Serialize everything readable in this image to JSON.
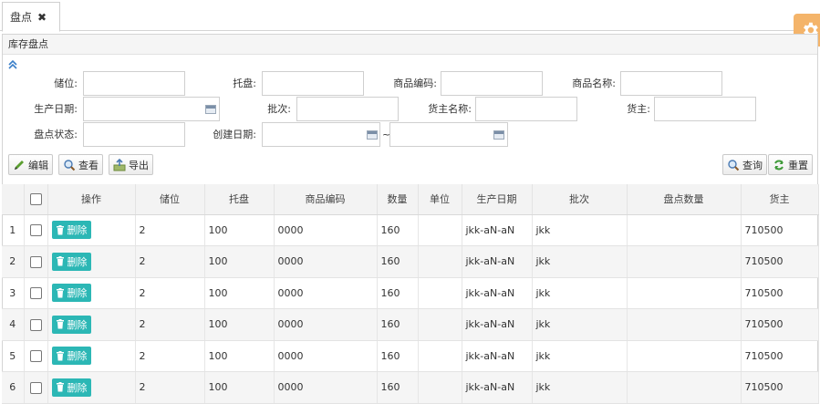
{
  "tab": {
    "label": "盘点",
    "close": "✖"
  },
  "panel": {
    "title": "库存盘点"
  },
  "form": {
    "location_label": "储位:",
    "pallet_label": "托盘:",
    "product_code_label": "商品编码:",
    "product_name_label": "商品名称:",
    "production_date_label": "生产日期:",
    "batch_label": "批次:",
    "owner_name_label": "货主名称:",
    "owner_label": "货主:",
    "count_status_label": "盘点状态:",
    "created_date_label": "创建日期:",
    "range_separator": "~"
  },
  "toolbar": {
    "edit": "编辑",
    "view": "查看",
    "export": "导出",
    "query": "查询",
    "reset": "重置"
  },
  "table": {
    "columns": [
      "",
      "操作",
      "储位",
      "托盘",
      "商品编码",
      "数量",
      "单位",
      "生产日期",
      "批次",
      "盘点数量",
      "货主"
    ],
    "delete_label": "删除",
    "rows": [
      {
        "no": "1",
        "loc": "2",
        "pallet": "100",
        "code": "0000",
        "qty": "160",
        "unit": "",
        "date": "jkk-aN-aN",
        "batch": "jkk",
        "count": "",
        "owner": "710500"
      },
      {
        "no": "2",
        "loc": "2",
        "pallet": "100",
        "code": "0000",
        "qty": "160",
        "unit": "",
        "date": "jkk-aN-aN",
        "batch": "jkk",
        "count": "",
        "owner": "710500"
      },
      {
        "no": "3",
        "loc": "2",
        "pallet": "100",
        "code": "0000",
        "qty": "160",
        "unit": "",
        "date": "jkk-aN-aN",
        "batch": "jkk",
        "count": "",
        "owner": "710500"
      },
      {
        "no": "4",
        "loc": "2",
        "pallet": "100",
        "code": "0000",
        "qty": "160",
        "unit": "",
        "date": "jkk-aN-aN",
        "batch": "jkk",
        "count": "",
        "owner": "710500"
      },
      {
        "no": "5",
        "loc": "2",
        "pallet": "100",
        "code": "0000",
        "qty": "160",
        "unit": "",
        "date": "jkk-aN-aN",
        "batch": "jkk",
        "count": "",
        "owner": "710500"
      },
      {
        "no": "6",
        "loc": "2",
        "pallet": "100",
        "code": "0000",
        "qty": "160",
        "unit": "",
        "date": "jkk-aN-aN",
        "batch": "jkk",
        "count": "",
        "owner": "710500"
      }
    ]
  },
  "colors": {
    "accent": "#2cb7b5",
    "gear_bg": "#f4b46a",
    "link": "#3a7fc9"
  }
}
